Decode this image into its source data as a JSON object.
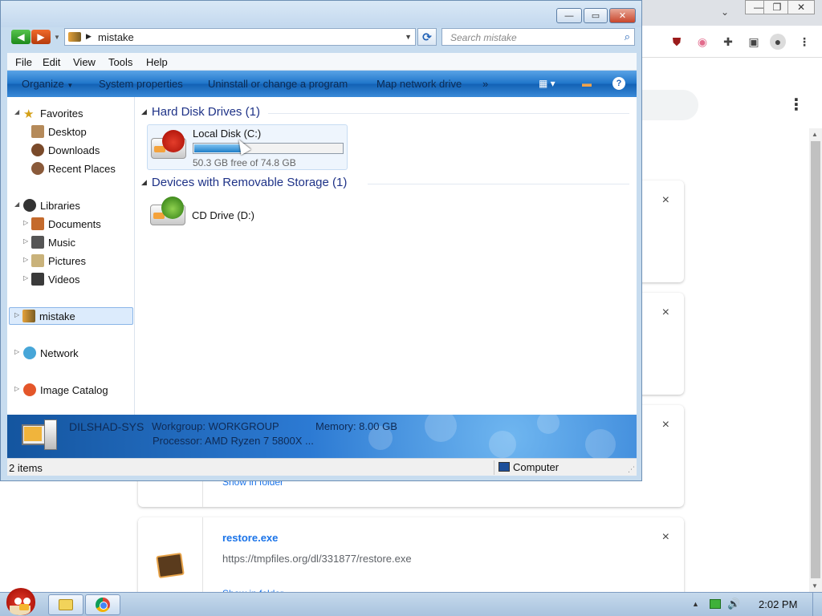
{
  "background_browser": {
    "downloads": [
      {
        "name": "",
        "url": "",
        "link": ""
      },
      {
        "name": "",
        "url": "",
        "link": ""
      },
      {
        "name": "",
        "url": "",
        "link": "Show in folder"
      },
      {
        "name": "restore.exe",
        "url": "https://tmpfiles.org/dl/331877/restore.exe",
        "link": "Show in folder"
      }
    ],
    "close_glyph": "×"
  },
  "explorer": {
    "address": {
      "path": "mistake"
    },
    "search": {
      "placeholder": "Search mistake"
    },
    "menu": [
      "File",
      "Edit",
      "View",
      "Tools",
      "Help"
    ],
    "commands": {
      "organize": "Organize",
      "system_properties": "System properties",
      "uninstall": "Uninstall or change a program",
      "map_drive": "Map network drive",
      "more": "»",
      "help": "?"
    },
    "nav": {
      "favorites": "Favorites",
      "desktop": "Desktop",
      "downloads": "Downloads",
      "recent": "Recent Places",
      "libraries": "Libraries",
      "documents": "Documents",
      "music": "Music",
      "pictures": "Pictures",
      "videos": "Videos",
      "mistake": "mistake",
      "network": "Network",
      "image_catalog": "Image Catalog"
    },
    "groups": {
      "hard_disks": "Hard Disk Drives (1)",
      "removable": "Devices with Removable Storage (1)"
    },
    "drives": {
      "local_name": "Local Disk (C:)",
      "local_free": "50.3 GB free of 74.8 GB",
      "local_used_fraction": 0.33,
      "cd_name": "CD Drive (D:)"
    },
    "details": {
      "computer_name": "DILSHAD-SYS",
      "workgroup": "Workgroup: WORKGROUP",
      "memory": "Memory: 8.00 GB",
      "processor": "Processor: AMD Ryzen 7 5800X ..."
    },
    "status": {
      "items": "2 items",
      "location": "Computer"
    }
  },
  "taskbar": {
    "clock": "2:02 PM"
  },
  "colors": {
    "accent": "#1d5fb5",
    "group_header": "#1e3287",
    "link": "#1a73e8"
  }
}
